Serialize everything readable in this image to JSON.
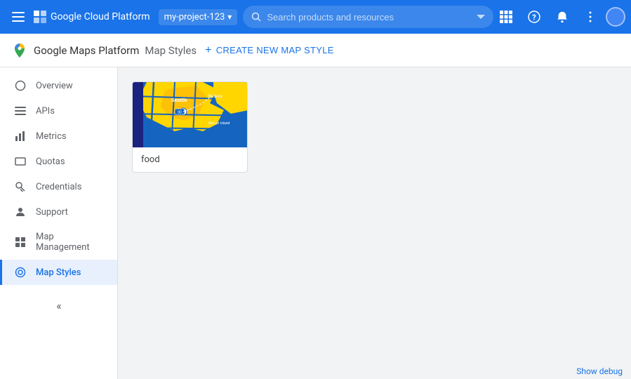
{
  "topbar": {
    "menu_icon": "☰",
    "title": "Google Cloud Platform",
    "project_name": "my-project-123",
    "search_placeholder": "Search products and resources",
    "icons": {
      "grid": "⊞",
      "help": "?",
      "bell": "🔔",
      "more": "⋮"
    }
  },
  "subheader": {
    "product_name": "Google Maps Platform",
    "page_title": "Map Styles",
    "create_btn_label": "CREATE NEW MAP STYLE",
    "create_icon": "+"
  },
  "sidebar": {
    "items": [
      {
        "id": "overview",
        "label": "Overview",
        "icon": "○"
      },
      {
        "id": "apis",
        "label": "APIs",
        "icon": "≡"
      },
      {
        "id": "metrics",
        "label": "Metrics",
        "icon": "↑"
      },
      {
        "id": "quotas",
        "label": "Quotas",
        "icon": "▭"
      },
      {
        "id": "credentials",
        "label": "Credentials",
        "icon": "⚿"
      },
      {
        "id": "support",
        "label": "Support",
        "icon": "👤"
      },
      {
        "id": "map-management",
        "label": "Map Management",
        "icon": "▦"
      },
      {
        "id": "map-styles",
        "label": "Map Styles",
        "icon": "◎",
        "active": true
      }
    ],
    "collapse_icon": "«"
  },
  "main": {
    "cards": [
      {
        "id": "food",
        "label": "food",
        "preview_type": "map-blue-yellow"
      }
    ]
  },
  "bottombar": {
    "label": "Show debug"
  },
  "colors": {
    "primary": "#1a73e8",
    "topbar_bg": "#1a73e8",
    "active_nav": "#1a73e8",
    "active_nav_bg": "#e8f0fe"
  }
}
